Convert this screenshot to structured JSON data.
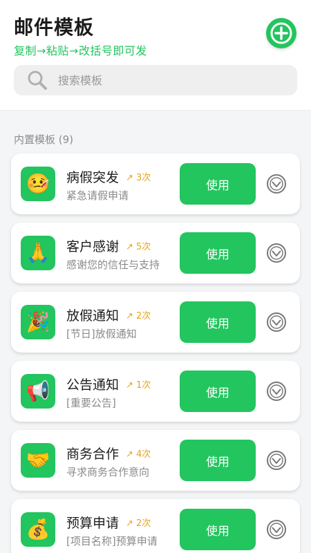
{
  "header": {
    "title": "邮件模板",
    "subtitle": "复制→粘贴→改括号即可发"
  },
  "search": {
    "placeholder": "搜索模板"
  },
  "section": {
    "label": "内置模板 (9)"
  },
  "colors": {
    "accent": "#22c55e",
    "count": "#e8a317"
  },
  "templates": [
    {
      "icon": "🤒",
      "title": "病假突发",
      "count": "↗ 3次",
      "desc": "紧急请假申请",
      "button": "使用"
    },
    {
      "icon": "🙏",
      "title": "客户感谢",
      "count": "↗ 5次",
      "desc": "感谢您的信任与支持",
      "button": "使用"
    },
    {
      "icon": "🎉",
      "title": "放假通知",
      "count": "↗ 2次",
      "desc": "[节日]放假通知",
      "button": "使用"
    },
    {
      "icon": "📢",
      "title": "公告通知",
      "count": "↗ 1次",
      "desc": "[重要公告]",
      "button": "使用"
    },
    {
      "icon": "🤝",
      "title": "商务合作",
      "count": "↗ 4次",
      "desc": "寻求商务合作意向",
      "button": "使用"
    },
    {
      "icon": "💰",
      "title": "预算申请",
      "count": "↗ 2次",
      "desc": "[项目名称]预算申请",
      "button": "使用"
    }
  ]
}
